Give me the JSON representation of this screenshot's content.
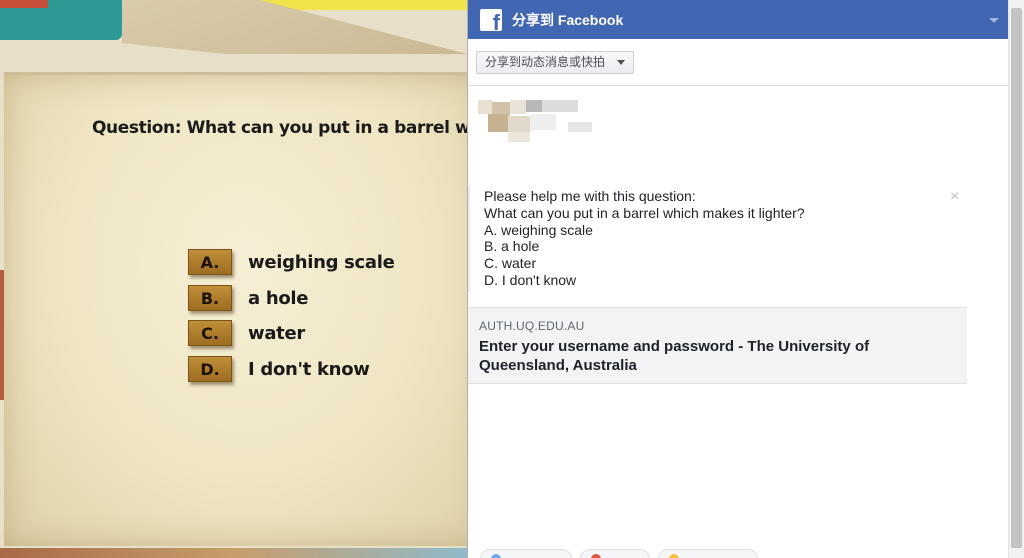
{
  "quiz": {
    "question": "Question: What can you put in a barrel which",
    "options": [
      {
        "letter": "A.",
        "text": "weighing scale"
      },
      {
        "letter": "B.",
        "text": "a hole"
      },
      {
        "letter": "C.",
        "text": "water"
      },
      {
        "letter": "D.",
        "text": "I don't know"
      }
    ]
  },
  "fb": {
    "title": "分享到 Facebook",
    "logo_glyph": "f",
    "icon": "facebook-logo-icon",
    "share_target": "分享到动态消息或快拍",
    "message": {
      "line1": "Please help me with this question:",
      "line2": "What can you put in a barrel which makes it lighter?",
      "line3": "A. weighing scale",
      "line4": "B. a hole",
      "line5": "C. water",
      "line6": "D. I don't know"
    },
    "close_glyph": "×",
    "link": {
      "domain": "AUTH.UQ.EDU.AU",
      "title": "Enter your username and password - The University of Queensland, Australia"
    },
    "accent": "#4267b2"
  }
}
